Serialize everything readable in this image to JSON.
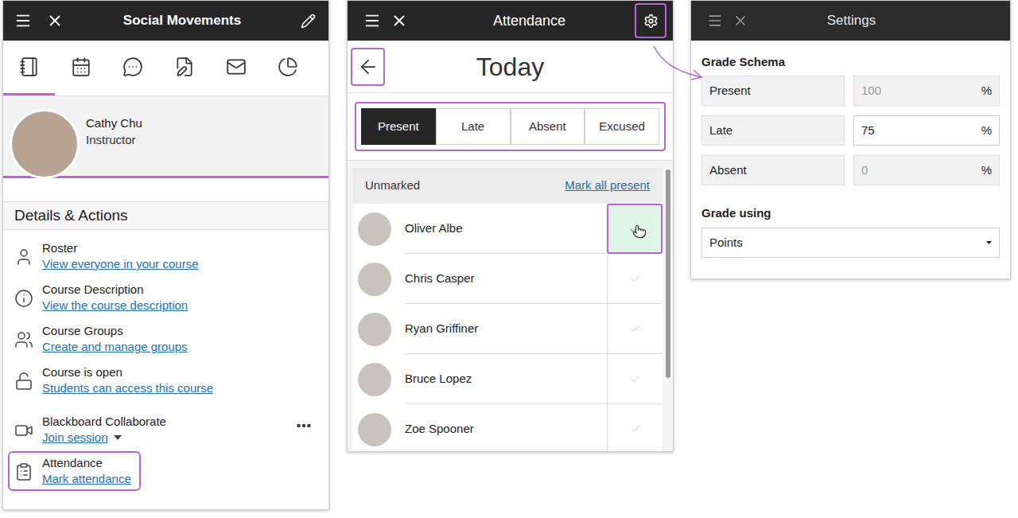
{
  "course": {
    "title": "Social Movements",
    "tabs": [
      {
        "selected": true
      },
      {
        "selected": false
      },
      {
        "selected": false
      },
      {
        "selected": false
      },
      {
        "selected": false
      },
      {
        "selected": false
      }
    ],
    "instructor": {
      "name": "Cathy Chu",
      "role": "Instructor"
    },
    "section_title": "Details & Actions",
    "actions": [
      {
        "label": "Roster",
        "link": "View everyone in your course",
        "kind": "link",
        "highlighted": false
      },
      {
        "label": "Course Description",
        "link": "View the course description",
        "kind": "link",
        "highlighted": false
      },
      {
        "label": "Course Groups",
        "link": "Create and manage groups",
        "kind": "link",
        "highlighted": false
      },
      {
        "label": "Course is open",
        "link": "Students can access this course",
        "kind": "link",
        "highlighted": false
      },
      {
        "label": "Blackboard Collaborate",
        "link": "Join session",
        "kind": "session",
        "highlighted": false
      },
      {
        "label": "Attendance",
        "link": "Mark attendance",
        "kind": "link",
        "highlighted": true
      }
    ]
  },
  "attendance": {
    "title": "Attendance",
    "settings_highlighted": true,
    "date": "Today",
    "back_highlighted": true,
    "statuses_highlighted": true,
    "statuses": [
      {
        "label": "Present",
        "selected": true
      },
      {
        "label": "Late",
        "selected": false
      },
      {
        "label": "Absent",
        "selected": false
      },
      {
        "label": "Excused",
        "selected": false
      }
    ],
    "unmarked_label": "Unmarked",
    "mark_all": "Mark all present",
    "students": [
      {
        "name": "Oliver Albe",
        "hovered": true,
        "highlighted": true
      },
      {
        "name": "Chris Casper",
        "hovered": false,
        "highlighted": false
      },
      {
        "name": "Ryan Griffiner",
        "hovered": false,
        "highlighted": false
      },
      {
        "name": "Bruce Lopez",
        "hovered": false,
        "highlighted": false
      },
      {
        "name": "Zoe Spooner",
        "hovered": false,
        "highlighted": false
      }
    ]
  },
  "settings": {
    "title": "Settings",
    "schema_label": "Grade Schema",
    "schema": [
      {
        "label": "Present",
        "value": "100",
        "unit": "%",
        "editable": false
      },
      {
        "label": "Late",
        "value": "75",
        "unit": "%",
        "editable": true
      },
      {
        "label": "Absent",
        "value": "0",
        "unit": "%",
        "editable": false
      }
    ],
    "grade_using_label": "Grade using",
    "grade_using": "Points"
  }
}
